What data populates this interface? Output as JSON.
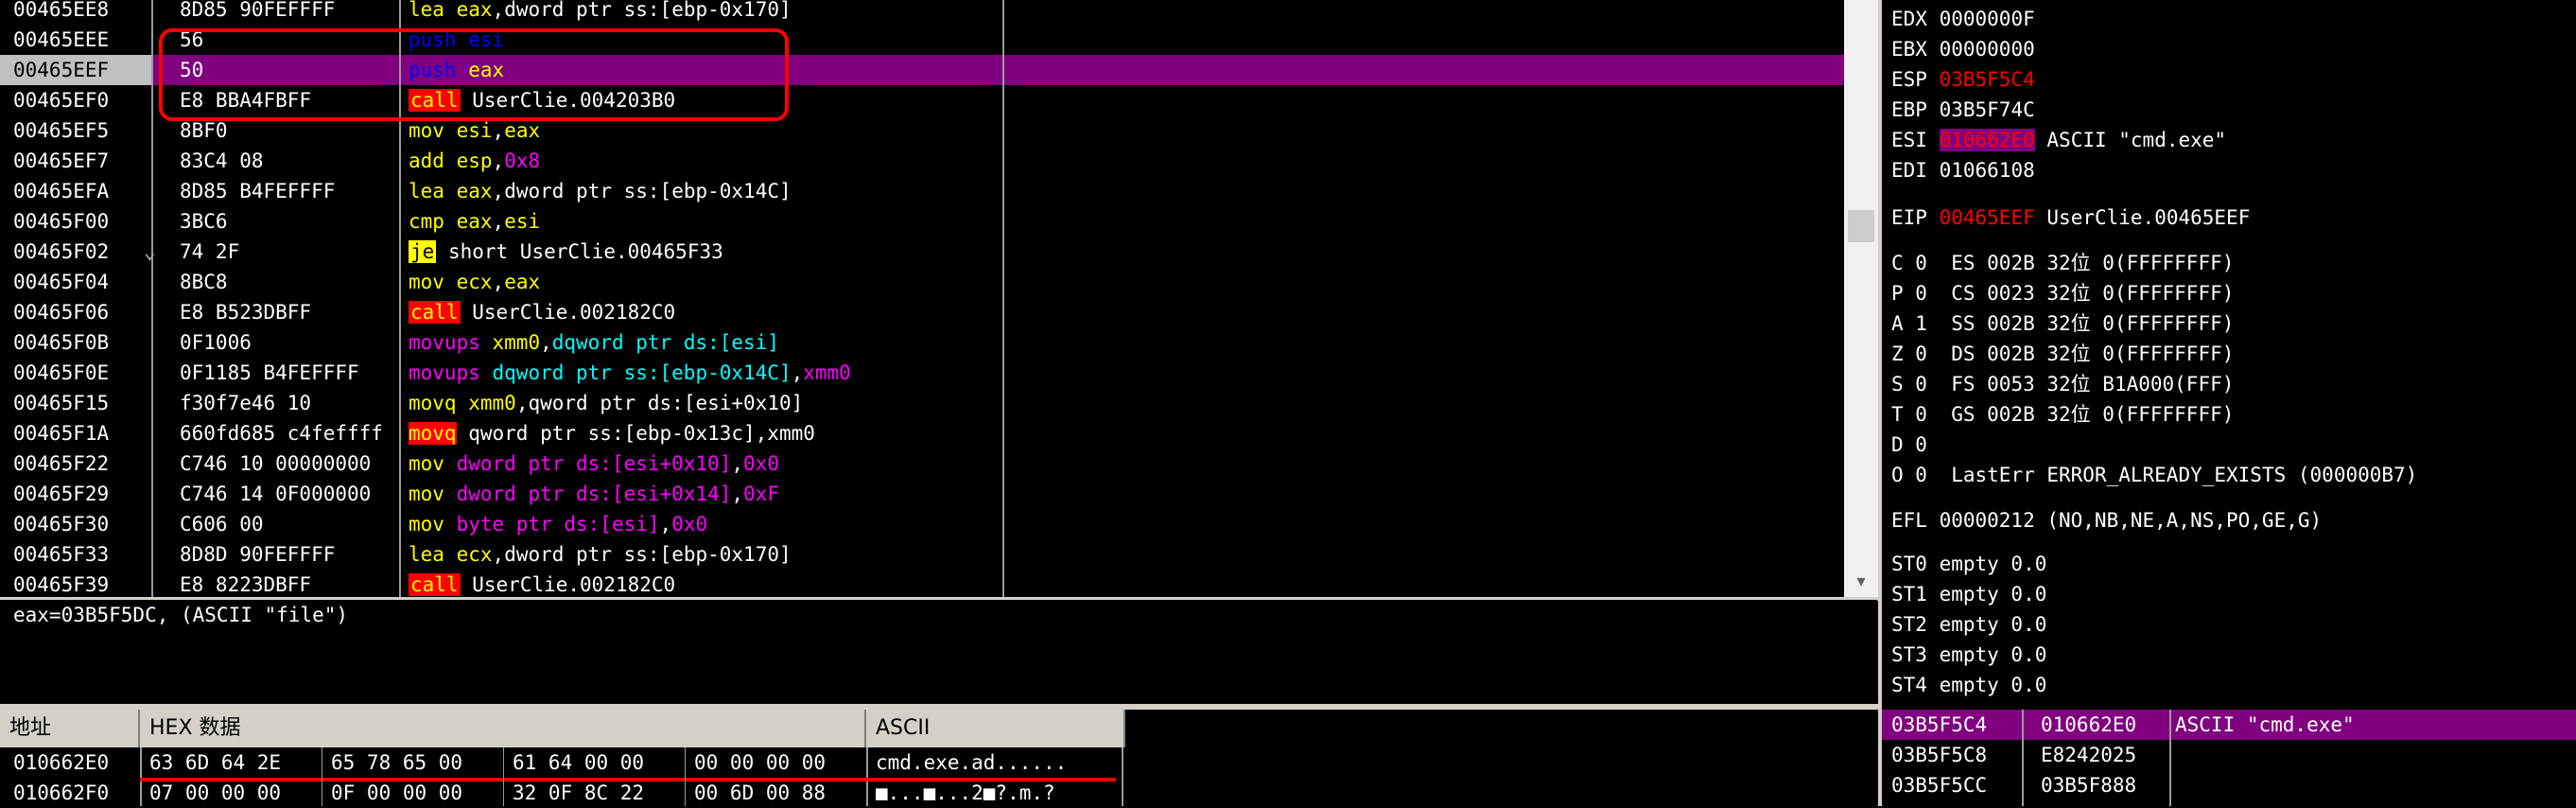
{
  "disasm": {
    "rows": [
      {
        "addr": "00465EE8",
        "hex": "8D85 90FEFFFF",
        "jmp": "",
        "mn": "lea",
        "kind": "normal",
        "ops": [
          {
            "t": "reg",
            "v": "eax"
          },
          {
            "t": "ops",
            "v": ","
          },
          {
            "t": "ops",
            "v": "dword ptr ss:[ebp-0x170]"
          }
        ]
      },
      {
        "addr": "00465EEE",
        "hex": "56",
        "jmp": "",
        "mn": "push",
        "kind": "push",
        "ops": [
          {
            "t": "push",
            "v": "esi"
          }
        ]
      },
      {
        "addr": "00465EEF",
        "hex": "50",
        "jmp": "",
        "mn": "push",
        "kind": "push",
        "ops": [
          {
            "t": "reg",
            "v": "eax"
          }
        ],
        "selected": true
      },
      {
        "addr": "00465EF0",
        "hex": "E8 BBA4FBFF",
        "jmp": "",
        "mn": "call",
        "kind": "call",
        "ops": [
          {
            "t": "ops",
            "v": "UserClie.004203B0"
          }
        ]
      },
      {
        "addr": "00465EF5",
        "hex": "8BF0",
        "jmp": "",
        "mn": "mov",
        "kind": "normal",
        "ops": [
          {
            "t": "reg",
            "v": "esi"
          },
          {
            "t": "ops",
            "v": ","
          },
          {
            "t": "reg",
            "v": "eax"
          }
        ]
      },
      {
        "addr": "00465EF7",
        "hex": "83C4 08",
        "jmp": "",
        "mn": "add",
        "kind": "normal",
        "ops": [
          {
            "t": "reg",
            "v": "esp"
          },
          {
            "t": "ops",
            "v": ","
          },
          {
            "t": "imm",
            "v": "0x8"
          }
        ]
      },
      {
        "addr": "00465EFA",
        "hex": "8D85 B4FEFFFF",
        "jmp": "",
        "mn": "lea",
        "kind": "normal",
        "ops": [
          {
            "t": "reg",
            "v": "eax"
          },
          {
            "t": "ops",
            "v": ","
          },
          {
            "t": "ops",
            "v": "dword ptr ss:[ebp-0x14C]"
          }
        ]
      },
      {
        "addr": "00465F00",
        "hex": "3BC6",
        "jmp": "",
        "mn": "cmp",
        "kind": "normal",
        "ops": [
          {
            "t": "reg",
            "v": "eax"
          },
          {
            "t": "ops",
            "v": ","
          },
          {
            "t": "reg",
            "v": "esi"
          }
        ]
      },
      {
        "addr": "00465F02",
        "hex": "74 2F",
        "jmp": "⌄",
        "mn": "je",
        "kind": "jcc",
        "ops": [
          {
            "t": "ops",
            "v": "short UserClie.00465F33"
          }
        ]
      },
      {
        "addr": "00465F04",
        "hex": "8BC8",
        "jmp": "",
        "mn": "mov",
        "kind": "normal",
        "ops": [
          {
            "t": "reg",
            "v": "ecx"
          },
          {
            "t": "ops",
            "v": ","
          },
          {
            "t": "reg",
            "v": "eax"
          }
        ]
      },
      {
        "addr": "00465F06",
        "hex": "E8 B523DBFF",
        "jmp": "",
        "mn": "call",
        "kind": "call",
        "ops": [
          {
            "t": "ops",
            "v": "UserClie.002182C0"
          }
        ]
      },
      {
        "addr": "00465F0B",
        "hex": "0F1006",
        "jmp": "",
        "mn": "movups",
        "kind": "sse",
        "ops": [
          {
            "t": "reg",
            "v": "xmm0"
          },
          {
            "t": "ops",
            "v": ","
          },
          {
            "t": "mem",
            "v": "dqword ptr ds:[esi]"
          }
        ]
      },
      {
        "addr": "00465F0E",
        "hex": "0F1185 B4FEFFFF",
        "jmp": "",
        "mn": "movups",
        "kind": "sse",
        "ops": [
          {
            "t": "mem",
            "v": "dqword ptr ss:[ebp-0x14C]"
          },
          {
            "t": "ops",
            "v": ","
          },
          {
            "t": "imm",
            "v": "xmm0"
          }
        ]
      },
      {
        "addr": "00465F15",
        "hex": "f30f7e46 10",
        "jmp": "",
        "mn": "movq",
        "kind": "movq",
        "ops": [
          {
            "t": "reg",
            "v": "xmm0"
          },
          {
            "t": "ops",
            "v": ","
          },
          {
            "t": "ops",
            "v": "qword ptr ds:[esi+0x10]"
          }
        ]
      },
      {
        "addr": "00465F1A",
        "hex": "660fd685 c4feffff",
        "jmp": "",
        "mn": "movq",
        "kind": "movq2",
        "ops": [
          {
            "t": "ops",
            "v": "qword ptr ss:[ebp-0x13c],xmm0"
          }
        ]
      },
      {
        "addr": "00465F22",
        "hex": "C746 10 00000000",
        "jmp": "",
        "mn": "mov",
        "kind": "normal",
        "ops": [
          {
            "t": "imm",
            "v": "dword ptr ds:[esi+0x10]"
          },
          {
            "t": "ops",
            "v": ","
          },
          {
            "t": "imm",
            "v": "0x0"
          }
        ]
      },
      {
        "addr": "00465F29",
        "hex": "C746 14 0F000000",
        "jmp": "",
        "mn": "mov",
        "kind": "normal",
        "ops": [
          {
            "t": "imm",
            "v": "dword ptr ds:[esi+0x14]"
          },
          {
            "t": "ops",
            "v": ","
          },
          {
            "t": "imm",
            "v": "0xF"
          }
        ]
      },
      {
        "addr": "00465F30",
        "hex": "C606 00",
        "jmp": "",
        "mn": "mov",
        "kind": "normal",
        "ops": [
          {
            "t": "imm",
            "v": "byte ptr ds:[esi]"
          },
          {
            "t": "ops",
            "v": ","
          },
          {
            "t": "imm",
            "v": "0x0"
          }
        ]
      },
      {
        "addr": "00465F33",
        "hex": "8D8D 90FEFFFF",
        "jmp": "",
        "mn": "lea",
        "kind": "normal",
        "ops": [
          {
            "t": "reg",
            "v": "ecx"
          },
          {
            "t": "ops",
            "v": ","
          },
          {
            "t": "ops",
            "v": "dword ptr ss:[ebp-0x170]"
          }
        ]
      },
      {
        "addr": "00465F39",
        "hex": "E8 8223DBFF",
        "jmp": "",
        "mn": "call",
        "kind": "call",
        "ops": [
          {
            "t": "ops",
            "v": "UserClie.002182C0"
          }
        ]
      }
    ]
  },
  "info_line": "eax=03B5F5DC, (ASCII \"file\")",
  "dump": {
    "headers": {
      "address": "地址",
      "hex": "HEX 数据",
      "ascii": "ASCII"
    },
    "rows": [
      {
        "addr": "010662E0",
        "g1": "63 6D 64 2E",
        "g2": "65 78 65 00",
        "g3": "61 64 00 00",
        "g4": "00 00 00 00",
        "ascii": "cmd.exe.ad......"
      },
      {
        "addr": "010662F0",
        "g1": "07 00 00 00",
        "g2": "0F 00 00 00",
        "g3": "32 0F 8C 22",
        "g4": "00 6D 00 88",
        "ascii": "■...■...2■?.m.?"
      }
    ]
  },
  "registers": {
    "edx": {
      "name": "EDX",
      "value": "0000000F"
    },
    "ebx": {
      "name": "EBX",
      "value": "00000000"
    },
    "esp": {
      "name": "ESP",
      "value": "03B5F5C4"
    },
    "ebp": {
      "name": "EBP",
      "value": "03B5F74C"
    },
    "esi": {
      "name": "ESI",
      "value": "010662E0",
      "comment": "ASCII \"cmd.exe\""
    },
    "edi": {
      "name": "EDI",
      "value": "01066108"
    },
    "eip": {
      "name": "EIP",
      "value": "00465EEF",
      "comment": "UserClie.00465EEF"
    },
    "segs": [
      {
        "flag": "C 0",
        "seg": "ES 002B 32位 0(FFFFFFFF)"
      },
      {
        "flag": "P 0",
        "seg": "CS 0023 32位 0(FFFFFFFF)"
      },
      {
        "flag": "A 1",
        "seg": "SS 002B 32位 0(FFFFFFFF)"
      },
      {
        "flag": "Z 0",
        "seg": "DS 002B 32位 0(FFFFFFFF)"
      },
      {
        "flag": "S 0",
        "seg": "FS 0053 32位 B1A000(FFF)"
      },
      {
        "flag": "T 0",
        "seg": "GS 002B 32位 0(FFFFFFFF)"
      },
      {
        "flag": "D 0",
        "seg": ""
      },
      {
        "flag": "O 0",
        "seg": "LastErr ERROR_ALREADY_EXISTS (000000B7)"
      }
    ],
    "efl": "EFL 00000212 (NO,NB,NE,A,NS,PO,GE,G)",
    "fpu": [
      "ST0 empty 0.0",
      "ST1 empty 0.0",
      "ST2 empty 0.0",
      "ST3 empty 0.0",
      "ST4 empty 0.0"
    ]
  },
  "stack": {
    "rows": [
      {
        "addr": "03B5F5C4",
        "value": "010662E0",
        "comment": "ASCII \"cmd.exe\""
      },
      {
        "addr": "03B5F5C8",
        "value": "E8242025",
        "comment": ""
      },
      {
        "addr": "03B5F5CC",
        "value": "03B5F888",
        "comment": ""
      }
    ]
  },
  "colors": {
    "highlight": "#800080",
    "annotation": "#ff0000",
    "mnemonic": "#ffff00",
    "push": "#0000ff",
    "immediate": "#ff00ff",
    "memory": "#00ffff"
  }
}
